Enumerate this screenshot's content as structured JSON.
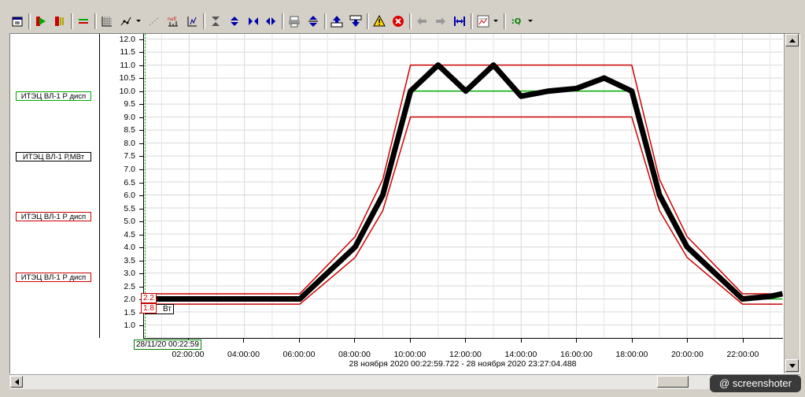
{
  "toolbar": {
    "buttons": [
      {
        "icon": "properties-icon"
      },
      {
        "icon": "play-icon"
      },
      {
        "icon": "pause-icon"
      },
      {
        "icon": "legend-icon"
      },
      {
        "icon": "grid-icon"
      },
      {
        "icon": "line-points-icon"
      },
      {
        "icon": "line-style-icon"
      },
      {
        "icon": "null-values-icon"
      },
      {
        "icon": "scale-icon"
      },
      {
        "icon": "fit-vertical-icon"
      },
      {
        "icon": "expand-vertical-icon"
      },
      {
        "icon": "compress-horizontal-icon"
      },
      {
        "icon": "expand-horizontal-icon"
      },
      {
        "icon": "print-icon"
      },
      {
        "icon": "zoom-vertical-icon"
      },
      {
        "icon": "export-icon"
      },
      {
        "icon": "import-icon"
      },
      {
        "icon": "warning-icon"
      },
      {
        "icon": "stop-icon"
      },
      {
        "icon": "arrow-left-icon"
      },
      {
        "icon": "arrow-right-icon"
      },
      {
        "icon": "fit-width-icon"
      },
      {
        "icon": "chart-settings-icon"
      },
      {
        "icon": "query-icon"
      }
    ],
    "query_label": ":Q"
  },
  "legend": [
    {
      "label": "ИТЭЦ ВЛ-1 Р дисп",
      "color": "#00aa00"
    },
    {
      "label": "ИТЭЦ ВЛ-1 Р,МВт",
      "color": "#000000"
    },
    {
      "label": "ИТЭЦ ВЛ-1 Р дисп",
      "color": "#cc0000"
    },
    {
      "label": "ИТЭЦ ВЛ-1 Р дисп",
      "color": "#cc0000"
    }
  ],
  "cursor": {
    "start_label": "28/11/20 00:22:59",
    "upper_value": "2.2",
    "lower_value": "1.8",
    "unit_fragment": "Вт"
  },
  "range_text": "28 ноября 2020 00:22:59.722 - 28 ноября 2020 23:27:04.488",
  "chart_data": {
    "type": "line",
    "x_unit": "hours",
    "xlim": [
      0.383,
      23.45
    ],
    "ylim": [
      0.5,
      12.2
    ],
    "y_ticks": [
      "1.0",
      "1.5",
      "2.0",
      "2.5",
      "3.0",
      "3.5",
      "4.0",
      "4.5",
      "5.0",
      "5.5",
      "6.0",
      "6.5",
      "7.0",
      "7.5",
      "8.0",
      "8.5",
      "9.0",
      "9.5",
      "10.0",
      "10.5",
      "11.0",
      "11.5",
      "12.0"
    ],
    "x_ticks": [
      "02:00:00",
      "04:00:00",
      "06:00:00",
      "08:00:00",
      "10:00:00",
      "12:00:00",
      "14:00:00",
      "16:00:00",
      "18:00:00",
      "20:00:00",
      "22:00:00"
    ],
    "grid": true,
    "series": [
      {
        "name": "ИТЭЦ ВЛ-1 Р,МВт",
        "color": "#000000",
        "x": [
          0.38,
          1,
          2,
          3,
          4,
          5,
          6,
          7,
          8,
          9,
          10,
          11,
          12,
          13,
          14,
          15,
          16,
          17,
          18,
          19,
          20,
          21,
          22,
          23,
          23.45
        ],
        "y": [
          2.0,
          2.0,
          2.0,
          2.0,
          2.0,
          2.0,
          2.0,
          3.0,
          4.0,
          6.0,
          10.0,
          11.0,
          10.0,
          11.0,
          9.8,
          10.0,
          10.1,
          10.5,
          10.0,
          6.0,
          4.0,
          3.0,
          2.0,
          2.1,
          2.2
        ]
      },
      {
        "name": "ИТЭЦ ВЛ-1 Р дисп",
        "color": "#00aa00",
        "x": [
          0.38,
          6,
          8,
          9,
          10,
          18,
          19,
          20,
          22,
          23.45
        ],
        "y": [
          2.0,
          2.0,
          4.0,
          6.0,
          10.0,
          10.0,
          6.0,
          4.0,
          2.0,
          2.0
        ]
      },
      {
        "name": "ИТЭЦ ВЛ-1 Р дисп",
        "color": "#cc0000",
        "x": [
          0.38,
          6,
          8,
          9,
          10,
          18,
          19,
          20,
          22,
          23.45
        ],
        "y": [
          2.2,
          2.2,
          4.4,
          6.6,
          11.0,
          11.0,
          6.6,
          4.4,
          2.2,
          2.2
        ]
      },
      {
        "name": "ИТЭЦ ВЛ-1 Р дисп",
        "color": "#cc0000",
        "x": [
          0.38,
          6,
          8,
          9,
          10,
          18,
          19,
          20,
          22,
          23.45
        ],
        "y": [
          1.8,
          1.8,
          3.6,
          5.4,
          9.0,
          9.0,
          5.4,
          3.6,
          1.8,
          1.8
        ]
      }
    ]
  }
}
